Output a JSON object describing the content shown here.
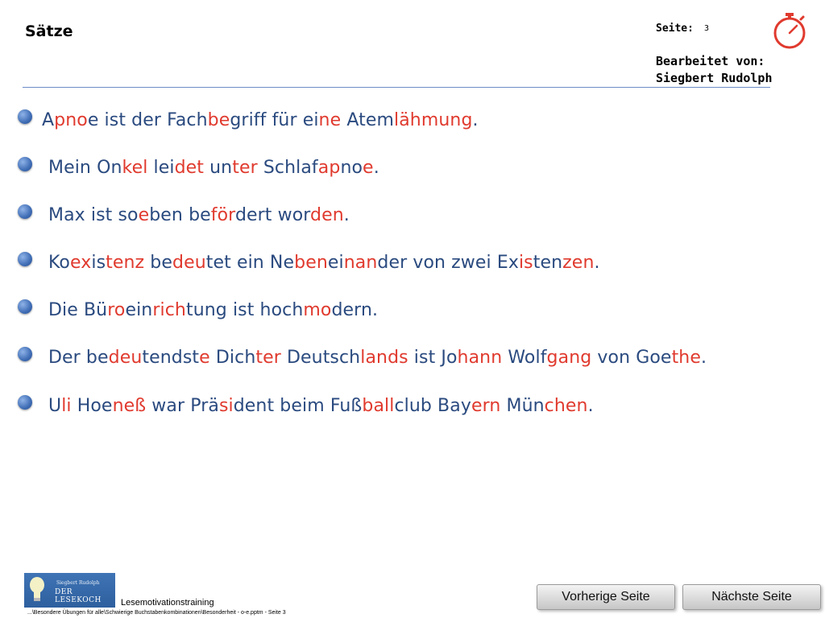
{
  "header": {
    "title": "Sätze",
    "page_label": "Seite:",
    "page_number": "3",
    "edited_by_label": "Bearbeitet von:",
    "edited_by_name": "Siegbert Rudolph",
    "timer_icon": "stopwatch-icon",
    "timer_color": "#e03a2e"
  },
  "colors": {
    "text_blue": "#2a4a7f",
    "highlight_red": "#e03a2e",
    "rule": "#6c8cc6"
  },
  "sentences": [
    [
      [
        "A",
        0
      ],
      [
        "pno",
        1
      ],
      [
        "e ist der Fach",
        0
      ],
      [
        "be",
        1
      ],
      [
        "griff für ei",
        0
      ],
      [
        "ne",
        1
      ],
      [
        " Atem",
        0
      ],
      [
        "läh",
        1
      ],
      [
        "mung",
        1
      ],
      [
        ".",
        0
      ]
    ],
    [
      [
        "Mein On",
        0
      ],
      [
        "kel",
        1
      ],
      [
        " lei",
        0
      ],
      [
        "det",
        1
      ],
      [
        " un",
        0
      ],
      [
        "ter",
        1
      ],
      [
        " Schlaf",
        0
      ],
      [
        "ap",
        1
      ],
      [
        "no",
        0
      ],
      [
        "e",
        1
      ],
      [
        ".",
        0
      ]
    ],
    [
      [
        "Max ist so",
        0
      ],
      [
        "e",
        1
      ],
      [
        "ben be",
        0
      ],
      [
        "för",
        1
      ],
      [
        "dert wor",
        0
      ],
      [
        "den",
        1
      ],
      [
        ".",
        0
      ]
    ],
    [
      [
        "Ko",
        0
      ],
      [
        "ex",
        1
      ],
      [
        "is",
        0
      ],
      [
        "tenz",
        1
      ],
      [
        " be",
        0
      ],
      [
        "deu",
        1
      ],
      [
        "tet ein Ne",
        0
      ],
      [
        "ben",
        1
      ],
      [
        "ei",
        0
      ],
      [
        "nan",
        1
      ],
      [
        "der von zwei Ex",
        0
      ],
      [
        "is",
        1
      ],
      [
        "ten",
        0
      ],
      [
        "zen",
        1
      ],
      [
        ".",
        0
      ]
    ],
    [
      [
        "Die Bü",
        0
      ],
      [
        "ro",
        1
      ],
      [
        "ein",
        0
      ],
      [
        "rich",
        1
      ],
      [
        "tung ist hoch",
        0
      ],
      [
        "mo",
        1
      ],
      [
        "dern.",
        0
      ]
    ],
    [
      [
        "Der be",
        0
      ],
      [
        "deu",
        1
      ],
      [
        "tendst",
        0
      ],
      [
        "e",
        1
      ],
      [
        " Dich",
        0
      ],
      [
        "ter",
        1
      ],
      [
        " Deutsch",
        0
      ],
      [
        "lands",
        1
      ],
      [
        " ist Jo",
        0
      ],
      [
        "hann",
        1
      ],
      [
        " Wolf",
        0
      ],
      [
        "gang",
        1
      ],
      [
        " von Goe",
        0
      ],
      [
        "the",
        1
      ],
      [
        ".",
        0
      ]
    ],
    [
      [
        "U",
        0
      ],
      [
        "li",
        1
      ],
      [
        " Hoe",
        0
      ],
      [
        "neß",
        1
      ],
      [
        " war Prä",
        0
      ],
      [
        "si",
        1
      ],
      [
        "dent beim Fuß",
        0
      ],
      [
        "ball",
        1
      ],
      [
        "club Bay",
        0
      ],
      [
        "ern",
        1
      ],
      [
        " Mün",
        0
      ],
      [
        "chen",
        1
      ],
      [
        ".",
        0
      ]
    ]
  ],
  "footer": {
    "logo_line1": "Siegbert Rudolph",
    "logo_line2": "DER LESEKOCH",
    "title": "Lesemotivationstraining",
    "path": "...\\Besondere Übungen für alle\\Schwierige Buchstabenkombinationen\\Besonderheit - o-e.pptm - Seite 3"
  },
  "buttons": {
    "prev_label": "Vorherige Seite",
    "next_label": "Nächste Seite"
  }
}
